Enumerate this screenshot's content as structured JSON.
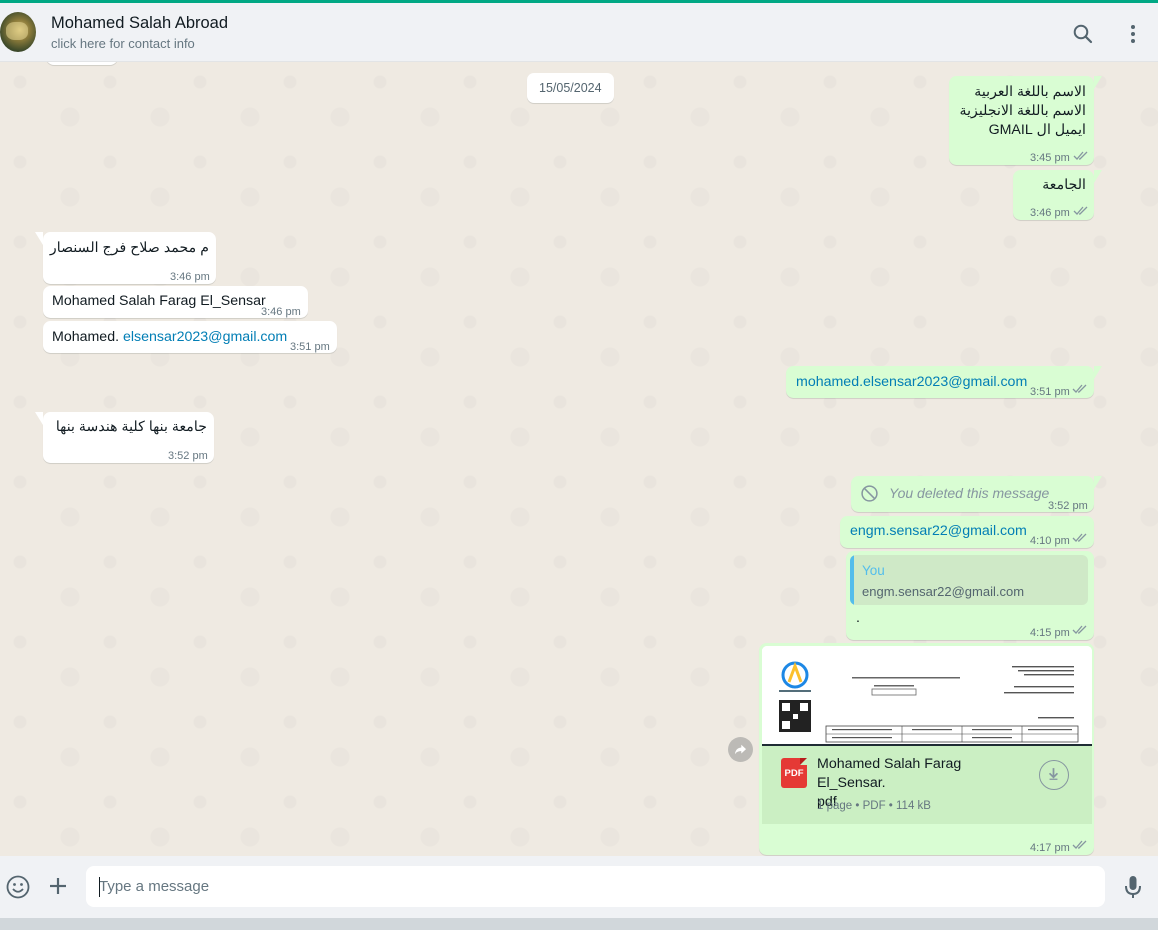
{
  "header": {
    "contact_name": "Mohamed Salah Abroad",
    "contact_subtitle": "click here for contact info",
    "icons": [
      "avatar",
      "search-icon",
      "menu-icon"
    ]
  },
  "chat": {
    "date_divider": "15/05/2024",
    "messages": [
      {
        "dir": "out",
        "lines": [
          "الاسم باللغة العربية",
          "الاسم باللغة الانجليزية",
          "ايميل ال GMAIL"
        ],
        "time": "3:45 pm",
        "status": "read"
      },
      {
        "dir": "out",
        "text": "الجامعة",
        "time": "3:46 pm",
        "status": "read"
      },
      {
        "dir": "in",
        "text": "م محمد صلاح فرج السنصار",
        "time": "3:46 pm"
      },
      {
        "dir": "in",
        "text": "Mohamed Salah Farag El_Sensar",
        "time": "3:46 pm"
      },
      {
        "dir": "in",
        "text_prefix": "Mohamed.",
        "link": "elsensar2023@gmail.com",
        "time": "3:51 pm"
      },
      {
        "dir": "out",
        "link": "mohamed.elsensar2023@gmail.com",
        "time": "3:51 pm",
        "status": "read"
      },
      {
        "dir": "in",
        "text": "جامعة بنها كلية هندسة بنها",
        "time": "3:52 pm"
      },
      {
        "dir": "out",
        "deleted_text": "You deleted this message",
        "time": "3:52 pm"
      },
      {
        "dir": "out",
        "link": "engm.sensar22@gmail.com",
        "time": "4:10 pm",
        "status": "read"
      },
      {
        "dir": "out",
        "quote_author": "You",
        "quote_text": "engm.sensar22@gmail.com",
        "text": ".",
        "time": "4:15 pm",
        "status": "read"
      },
      {
        "dir": "out",
        "document": {
          "name": "Mohamed Salah Farag El_Sensar.pdf",
          "name_line1": "Mohamed Salah Farag El_Sensar.",
          "name_line2": "pdf",
          "icon_label": "PDF",
          "meta": "1 page • PDF • 114 kB"
        },
        "time": "4:17 pm",
        "status": "read"
      }
    ]
  },
  "composer": {
    "placeholder": "Type a message",
    "value": ""
  },
  "colors": {
    "accent": "#00a884",
    "outgoing_bubble": "#d9fdd3",
    "incoming_bubble": "#ffffff",
    "chat_background": "#efeae2",
    "link": "#027eb5",
    "read_ticks": "#8696a0"
  }
}
